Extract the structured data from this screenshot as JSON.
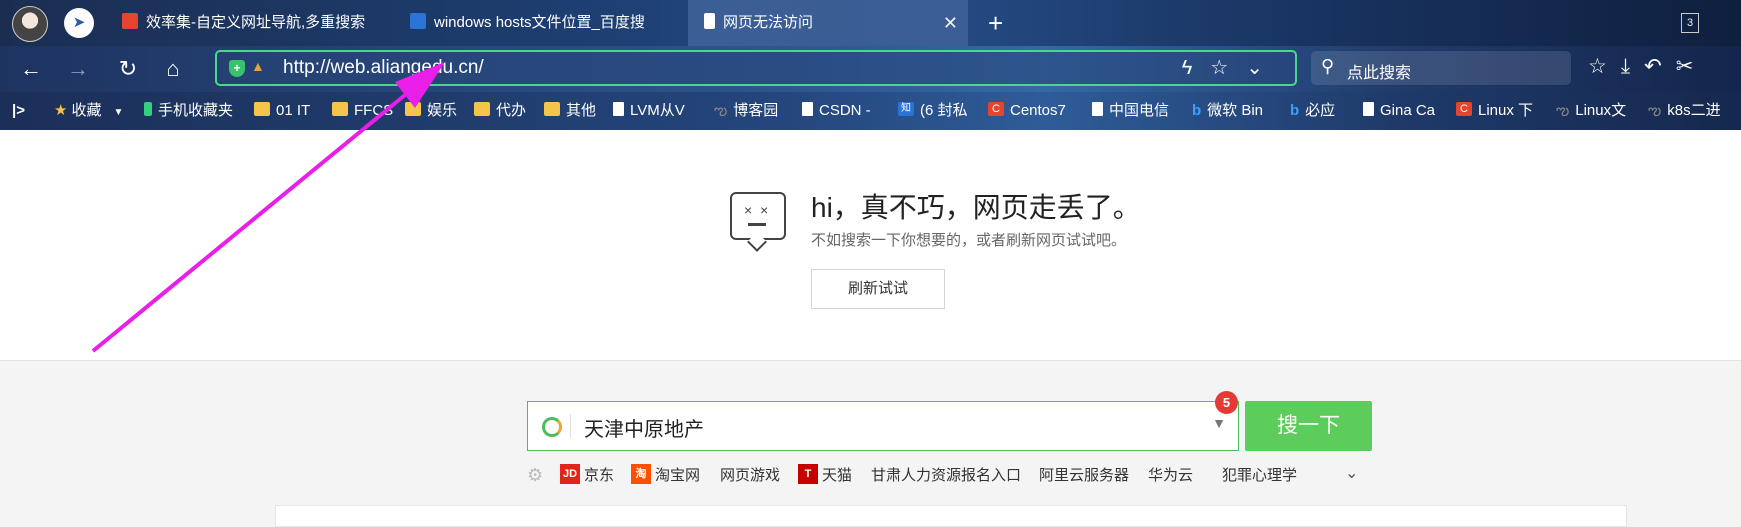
{
  "tabs": [
    {
      "title": "效率集-自定义网址导航,多重搜索",
      "icon_color": "#e5452e"
    },
    {
      "title": "windows hosts文件位置_百度搜",
      "icon_color": "#2b73d6"
    },
    {
      "title": "网页无法访问",
      "icon_color": "#ffffff",
      "active": true
    }
  ],
  "tab_count": "3",
  "address": {
    "url": "http://web.aliangedu.cn/"
  },
  "search": {
    "placeholder": "点此搜索"
  },
  "bookmarks": [
    {
      "label": "收藏",
      "icon": "star-icon"
    },
    {
      "label": "手机收藏夹",
      "icon": "phone-icon"
    },
    {
      "label": "01 IT",
      "icon": "folder-icon"
    },
    {
      "label": "FFCS",
      "icon": "folder-icon"
    },
    {
      "label": "娱乐",
      "icon": "folder-icon"
    },
    {
      "label": "代办",
      "icon": "folder-icon"
    },
    {
      "label": "其他",
      "icon": "folder-icon"
    },
    {
      "label": "LVM从V",
      "icon": "page-icon"
    },
    {
      "label": "博客园",
      "icon": "cnblogs-icon"
    },
    {
      "label": "CSDN -",
      "icon": "page-icon"
    },
    {
      "label": "(6 封私",
      "icon": "zhihu-icon"
    },
    {
      "label": "Centos7",
      "icon": "csdn-icon"
    },
    {
      "label": "中国电信",
      "icon": "page-icon"
    },
    {
      "label": "微软 Bin",
      "icon": "bing-icon"
    },
    {
      "label": "必应",
      "icon": "bing-icon"
    },
    {
      "label": "Gina Ca",
      "icon": "page-icon"
    },
    {
      "label": "Linux 下",
      "icon": "csdn-icon"
    },
    {
      "label": "Linux文",
      "icon": "cnblogs-icon"
    },
    {
      "label": "k8s二进",
      "icon": "cnblogs-icon"
    }
  ],
  "error": {
    "title": "hi，真不巧，网页走丢了。",
    "subtitle": "不如搜索一下你想要的，或者刷新网页试试吧。",
    "refresh_label": "刷新试试"
  },
  "home_search": {
    "value": "天津中原地产",
    "badge": "5",
    "button_label": "搜一下"
  },
  "quick_links": [
    {
      "label": "京东",
      "icon": "jd-icon",
      "icon_text": "JD",
      "color": "#e1251b"
    },
    {
      "label": "淘宝网",
      "icon": "taobao-icon",
      "icon_text": "淘",
      "color": "#ff5000"
    },
    {
      "label": "网页游戏",
      "icon": "",
      "icon_text": "",
      "color": ""
    },
    {
      "label": "天猫",
      "icon": "tmall-icon",
      "icon_text": "T",
      "color": "#c40000"
    },
    {
      "label": "甘肃人力资源报名入口",
      "icon": "",
      "icon_text": "",
      "color": ""
    },
    {
      "label": "阿里云服务器",
      "icon": "",
      "icon_text": "",
      "color": ""
    },
    {
      "label": "华为云",
      "icon": "",
      "icon_text": "",
      "color": ""
    },
    {
      "label": "犯罪心理学",
      "icon": "",
      "icon_text": "",
      "color": ""
    }
  ],
  "annotation_color": "#e91ee9"
}
